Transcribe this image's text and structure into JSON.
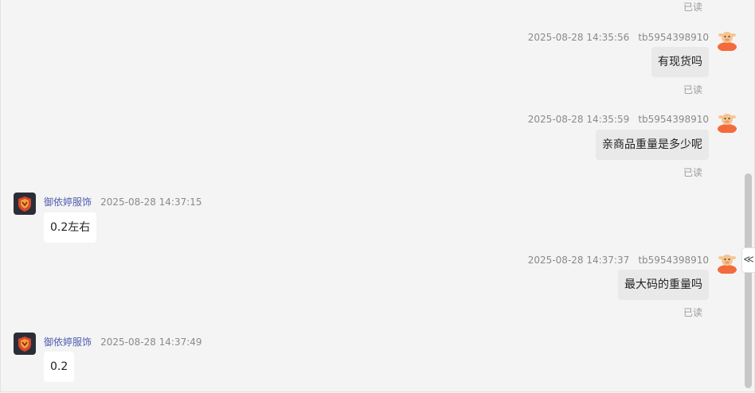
{
  "buyer": {
    "id": "tb5954398910",
    "avatar_icon": "cartoon-cow-avatar-icon"
  },
  "shop": {
    "name": "御依婷服饰",
    "avatar_icon": "shop-badge-avatar-icon"
  },
  "read_label": "已读",
  "top_read": "已读",
  "messages": [
    {
      "direction": "out",
      "time": "2025-08-28 14:35:56",
      "sender": "tb5954398910",
      "text": "有现货吗",
      "status": "已读"
    },
    {
      "direction": "out",
      "time": "2025-08-28 14:35:59",
      "sender": "tb5954398910",
      "text": "亲商品重量是多少呢",
      "status": "已读"
    },
    {
      "direction": "in",
      "time": "2025-08-28 14:37:15",
      "sender": "御依婷服饰",
      "text": "0.2左右"
    },
    {
      "direction": "out",
      "time": "2025-08-28 14:37:37",
      "sender": "tb5954398910",
      "text": "最大码的重量吗",
      "status": "已读"
    },
    {
      "direction": "in",
      "time": "2025-08-28 14:37:49",
      "sender": "御依婷服饰",
      "text": "0.2"
    }
  ],
  "collapse_toggle": "≪"
}
